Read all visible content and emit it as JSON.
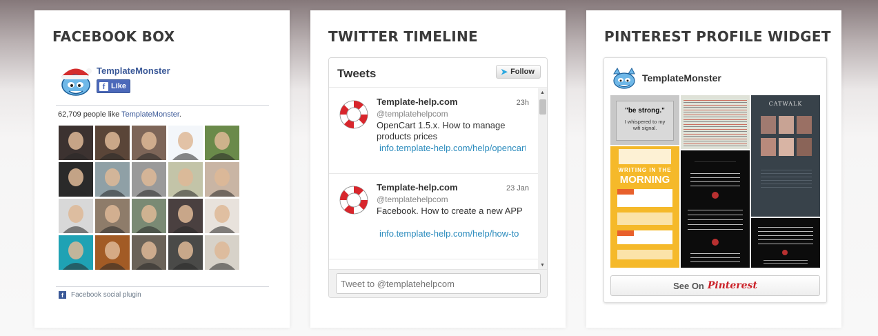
{
  "facebook": {
    "title": "FACEBOOK BOX",
    "page_name": "TemplateMonster",
    "like_label": "Like",
    "likes_count": "62,709 people like",
    "likes_page": "TemplateMonster",
    "likes_suffix": ".",
    "plugin_label": "Facebook social plugin",
    "faces": [
      {
        "bg": "#3c3230"
      },
      {
        "bg": "#5a4538"
      },
      {
        "bg": "#7d6558"
      },
      {
        "bg": "#f3f6fa"
      },
      {
        "bg": "#6a8a4a"
      },
      {
        "bg": "#2a2a2a"
      },
      {
        "bg": "#8fa0a6"
      },
      {
        "bg": "#9a9a9a"
      },
      {
        "bg": "#c3c4a8"
      },
      {
        "bg": "#c9b5a4"
      },
      {
        "bg": "#d8d8d8"
      },
      {
        "bg": "#8e7c6a"
      },
      {
        "bg": "#7a8a74"
      },
      {
        "bg": "#4a4040"
      },
      {
        "bg": "#e8e2dc"
      },
      {
        "bg": "#1fa2b4"
      },
      {
        "bg": "#a25b25"
      },
      {
        "bg": "#6a6258"
      },
      {
        "bg": "#4a4a48"
      },
      {
        "bg": "#d7d2c9"
      }
    ]
  },
  "twitter": {
    "title": "TWITTER TIMELINE",
    "header": "Tweets",
    "follow_label": "Follow",
    "tweets": [
      {
        "name": "Template-help.com",
        "handle": "@templatehelpcom",
        "time": "23h",
        "text": "OpenCart 1.5.x. How to manage products prices",
        "link": "info.template-help.com/help/opencart"
      },
      {
        "name": "Template-help.com",
        "handle": "@templatehelpcom",
        "time": "23 Jan",
        "text": "Facebook. How to create a new APP",
        "link": "info.template-help.com/help/how-to"
      }
    ],
    "reply_placeholder": "Tweet to @templatehelpcom"
  },
  "pinterest": {
    "title": "PINTEREST PROFILE WIDGET",
    "profile_name": "TemplateMonster",
    "see_on_label": "See On",
    "brand": "Pinterest",
    "pins": {
      "strong_quote": "\"be strong.\"",
      "strong_sub": "I whispered to my wifi signal.",
      "writing_a": "WRITING IN THE",
      "writing_b": "MORNING",
      "catwalk": "CATWALK"
    }
  },
  "colors": {
    "facebook_blue": "#3b5998",
    "twitter_link": "#2b8bbd",
    "pinterest_red": "#cb2027"
  }
}
